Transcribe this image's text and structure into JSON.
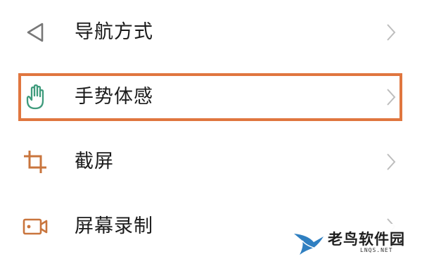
{
  "settings_list": {
    "items": [
      {
        "label": "导航方式",
        "icon": "navigation-back-icon"
      },
      {
        "label": "手势体感",
        "icon": "hand-gesture-icon",
        "highlighted": true
      },
      {
        "label": "截屏",
        "icon": "crop-screenshot-icon"
      },
      {
        "label": "屏幕录制",
        "icon": "screen-record-icon"
      }
    ]
  },
  "colors": {
    "highlight_border": "#e0763f",
    "icon_gray": "#777777",
    "icon_teal": "#3f9b7c",
    "icon_orange": "#c9753d",
    "chevron": "#bdbdbd"
  },
  "watermark": {
    "name": "老鸟软件园",
    "sub": "LNQS.NET"
  }
}
